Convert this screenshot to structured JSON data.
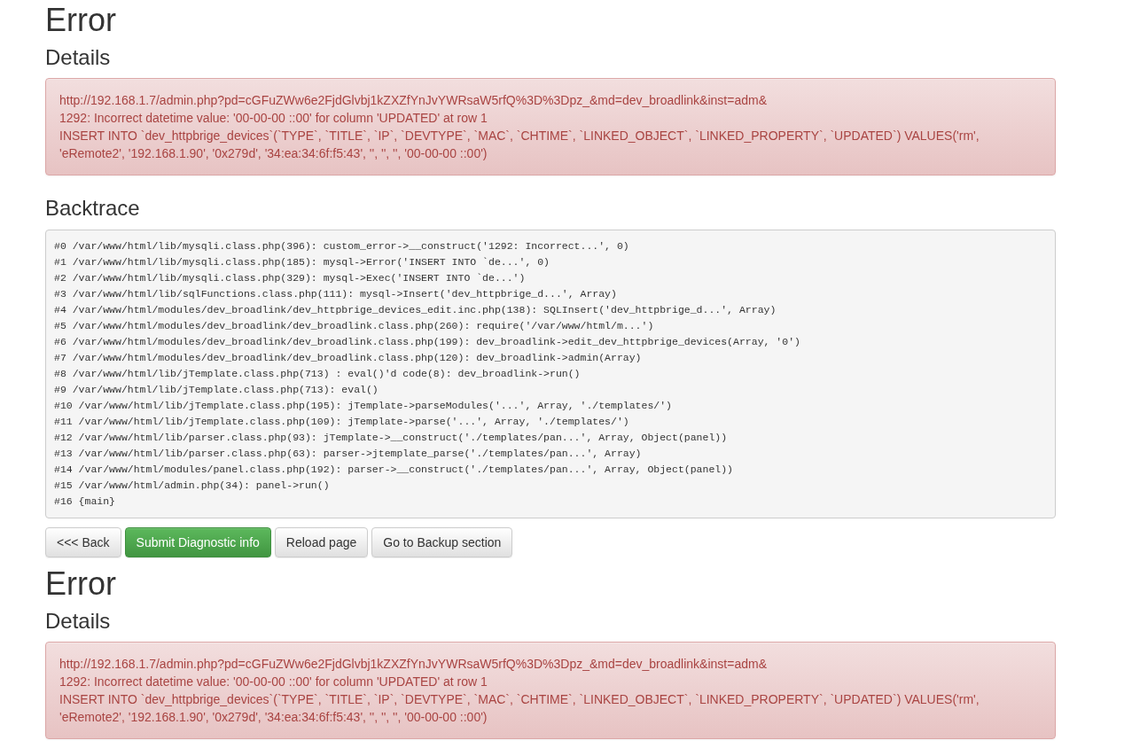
{
  "errors": [
    {
      "heading": "Error",
      "details_heading": "Details",
      "details": [
        "http://192.168.1.7/admin.php?pd=cGFuZWw6e2FjdGlvbj1kZXZfYnJvYWRsaW5rfQ%3D%3Dpz_&md=dev_broadlink&inst=adm&",
        "1292: Incorrect datetime value: '00-00-00 ::00' for column 'UPDATED' at row 1",
        "INSERT INTO `dev_httpbrige_devices`(`TYPE`, `TITLE`, `IP`, `DEVTYPE`, `MAC`, `CHTIME`, `LINKED_OBJECT`, `LINKED_PROPERTY`, `UPDATED`) VALUES('rm', 'eRemote2', '192.168.1.90', '0x279d', '34:ea:34:6f:f5:43', '', '', '', '00-00-00 ::00')"
      ],
      "backtrace_heading": "Backtrace",
      "backtrace": [
        "#0 /var/www/html/lib/mysqli.class.php(396): custom_error->__construct('1292: Incorrect...', 0)",
        "#1 /var/www/html/lib/mysqli.class.php(185): mysql->Error('INSERT INTO `de...', 0)",
        "#2 /var/www/html/lib/mysqli.class.php(329): mysql->Exec('INSERT INTO `de...')",
        "#3 /var/www/html/lib/sqlFunctions.class.php(111): mysql->Insert('dev_httpbrige_d...', Array)",
        "#4 /var/www/html/modules/dev_broadlink/dev_httpbrige_devices_edit.inc.php(138): SQLInsert('dev_httpbrige_d...', Array)",
        "#5 /var/www/html/modules/dev_broadlink/dev_broadlink.class.php(260): require('/var/www/html/m...')",
        "#6 /var/www/html/modules/dev_broadlink/dev_broadlink.class.php(199): dev_broadlink->edit_dev_httpbrige_devices(Array, '0')",
        "#7 /var/www/html/modules/dev_broadlink/dev_broadlink.class.php(120): dev_broadlink->admin(Array)",
        "#8 /var/www/html/lib/jTemplate.class.php(713) : eval()'d code(8): dev_broadlink->run()",
        "#9 /var/www/html/lib/jTemplate.class.php(713): eval()",
        "#10 /var/www/html/lib/jTemplate.class.php(195): jTemplate->parseModules('...', Array, './templates/')",
        "#11 /var/www/html/lib/jTemplate.class.php(109): jTemplate->parse('...', Array, './templates/')",
        "#12 /var/www/html/lib/parser.class.php(93): jTemplate->__construct('./templates/pan...', Array, Object(panel))",
        "#13 /var/www/html/lib/parser.class.php(63): parser->jtemplate_parse('./templates/pan...', Array)",
        "#14 /var/www/html/modules/panel.class.php(192): parser->__construct('./templates/pan...', Array, Object(panel))",
        "#15 /var/www/html/admin.php(34): panel->run()",
        "#16 {main}"
      ],
      "buttons": [
        {
          "label": "<<< Back",
          "kind": "default"
        },
        {
          "label": "Submit Diagnostic info",
          "kind": "success"
        },
        {
          "label": "Reload page",
          "kind": "default"
        },
        {
          "label": "Go to Backup section",
          "kind": "default"
        }
      ]
    },
    {
      "heading": "Error",
      "details_heading": "Details",
      "details": [
        "http://192.168.1.7/admin.php?pd=cGFuZWw6e2FjdGlvbj1kZXZfYnJvYWRsaW5rfQ%3D%3Dpz_&md=dev_broadlink&inst=adm&",
        "1292: Incorrect datetime value: '00-00-00 ::00' for column 'UPDATED' at row 1",
        "INSERT INTO `dev_httpbrige_devices`(`TYPE`, `TITLE`, `IP`, `DEVTYPE`, `MAC`, `CHTIME`, `LINKED_OBJECT`, `LINKED_PROPERTY`, `UPDATED`) VALUES('rm', 'eRemote2', '192.168.1.90', '0x279d', '34:ea:34:6f:f5:43', '', '', '', '00-00-00 ::00')"
      ]
    }
  ]
}
